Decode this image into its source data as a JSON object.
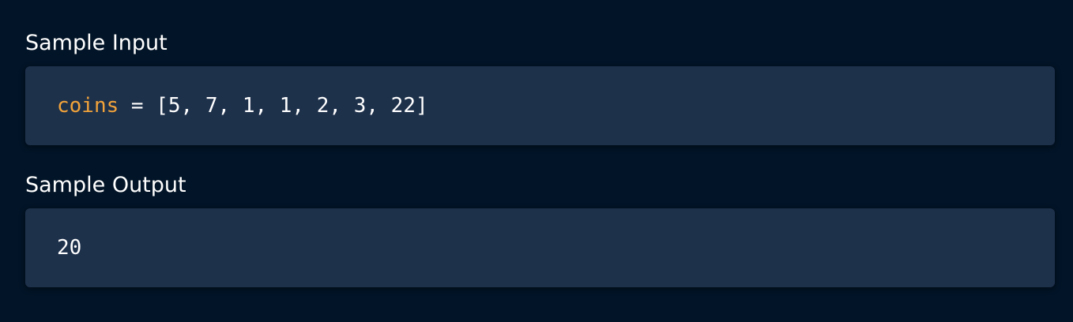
{
  "sample_input": {
    "title": "Sample Input",
    "code": {
      "variable": "coins",
      "operator": " = ",
      "value": "[5, 7, 1, 1, 2, 3, 22]"
    }
  },
  "sample_output": {
    "title": "Sample Output",
    "value": "20"
  },
  "colors": {
    "background": "#021427",
    "code_background": "#1e314b",
    "variable_highlight": "#f2a33a",
    "text": "#ffffff"
  }
}
